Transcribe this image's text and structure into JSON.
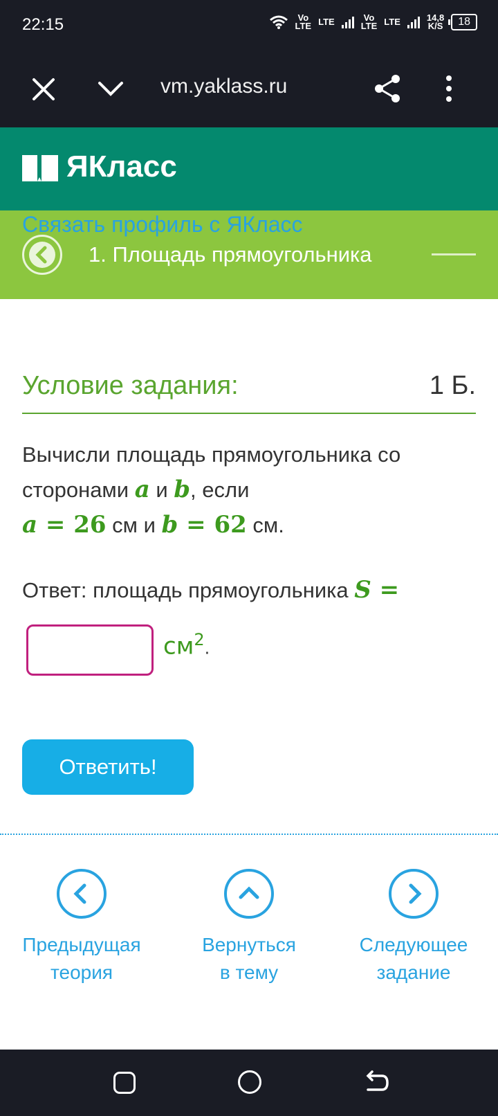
{
  "status": {
    "time": "22:15",
    "sim1_top": "Vo",
    "sim1_bottom": "LTE",
    "lte1": "LTE",
    "sim2_top": "Vo",
    "sim2_bottom": "LTE",
    "lte2": "LTE",
    "speed_value": "14,8",
    "speed_unit": "K/S",
    "battery": "18"
  },
  "browser": {
    "url": "vm.yaklass.ru"
  },
  "brand": {
    "name": "ЯКласс"
  },
  "topic": {
    "link_profile": "Связать профиль с ЯКласс",
    "title": "1. Площадь прямоугольника"
  },
  "task": {
    "heading": "Условие задания:",
    "points": "1 Б.",
    "q_line1": "Вычисли площадь прямоугольника со",
    "q_line2_pre": "сторонами ",
    "var_a": "a",
    "and": " и ",
    "var_b": "b",
    "q_line2_post": ", если",
    "eq_a": "a",
    "eq_sign1": " = ",
    "val_a": "26",
    "unit_cm1": " см и ",
    "eq_b": "b",
    "eq_sign2": " = ",
    "val_b": "62",
    "unit_cm2": " см.",
    "answer_prefix": "Ответ: площадь прямоугольника ",
    "answer_var": "S =",
    "answer_value": "",
    "answer_unit": "см",
    "answer_unit_power": "2",
    "answer_dot": "."
  },
  "actions": {
    "submit": "Ответить!"
  },
  "bottom_nav": {
    "prev_line1": "Предыдущая",
    "prev_line2": "теория",
    "up_line1": "Вернуться",
    "up_line2": "в тему",
    "next_line1": "Следующее",
    "next_line2": "задание"
  },
  "colors": {
    "brand": "#04896e",
    "topic_bar": "#8cc63f",
    "accent_green": "#5aa52f",
    "link_blue": "#29a3e0",
    "button_blue": "#17aee6",
    "input_border": "#c0207e"
  }
}
